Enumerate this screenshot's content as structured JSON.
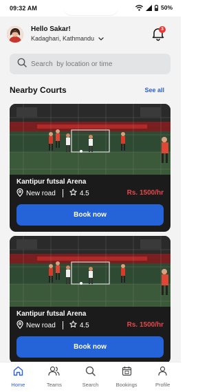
{
  "status_bar": {
    "time": "09:32 AM",
    "battery": "50%"
  },
  "header": {
    "greeting": "Hello Sakar!",
    "location": "Kadaghari, Kathmandu",
    "notification_count": "3"
  },
  "search": {
    "placeholder": "Search  by location or time"
  },
  "section": {
    "title": "Nearby Courts",
    "see_all": "See all"
  },
  "courts": [
    {
      "name": "Kantipur futsal Arena",
      "location": "New road",
      "rating": "4.5",
      "price": "Rs. 1500/hr",
      "button": "Book now"
    },
    {
      "name": "Kantipur futsal Arena",
      "location": "New road",
      "rating": "4.5",
      "price": "Rs. 1500/hr",
      "button": "Book now"
    }
  ],
  "nav": {
    "items": [
      {
        "label": "Home",
        "icon": "home-icon",
        "active": true
      },
      {
        "label": "Teams",
        "icon": "teams-icon",
        "active": false
      },
      {
        "label": "Search",
        "icon": "search-icon",
        "active": false
      },
      {
        "label": "Bookings",
        "icon": "calendar-icon",
        "active": false
      },
      {
        "label": "Profile",
        "icon": "user-icon",
        "active": false
      }
    ]
  },
  "colors": {
    "accent": "#2563d8",
    "price": "#e5484d",
    "badge": "#e53935",
    "card": "#1b1b1b"
  }
}
